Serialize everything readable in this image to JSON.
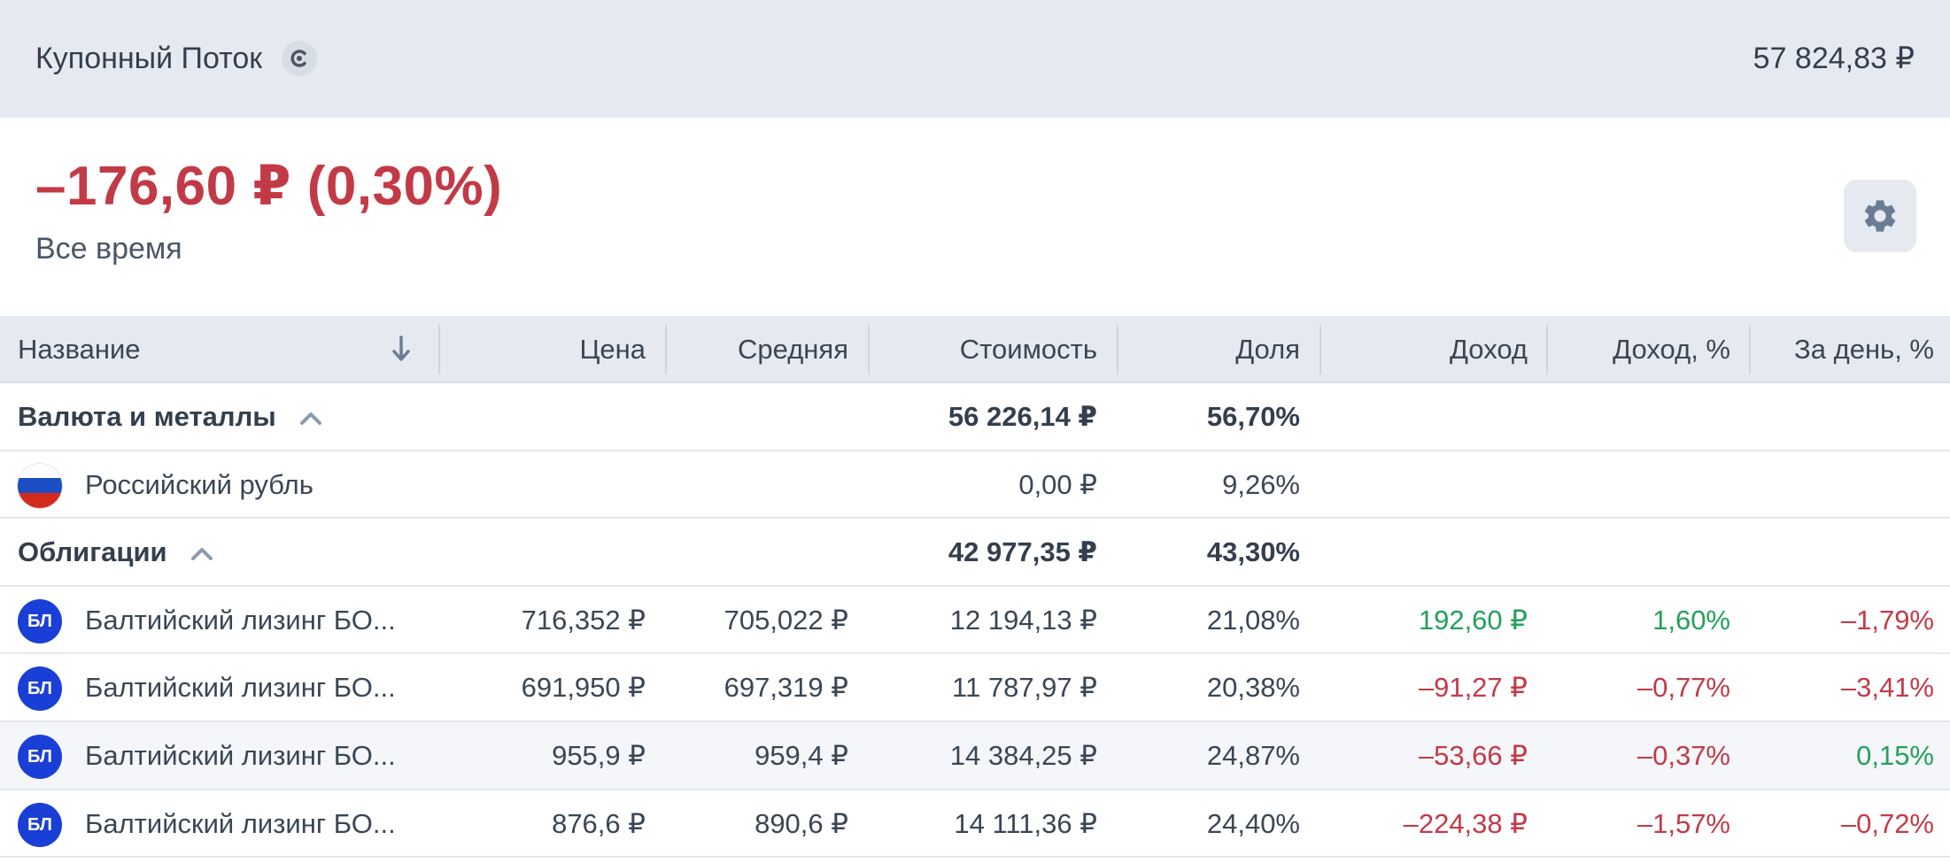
{
  "header": {
    "portfolio_name": "Купонный Поток",
    "portfolio_icon": "c-icon",
    "total_value": "57 824,83 ₽"
  },
  "summary": {
    "profit": "–176,60 ₽ (0,30%)",
    "period": "Все время",
    "settings_icon": "gear-icon"
  },
  "table": {
    "columns": {
      "name": "Название",
      "price": "Цена",
      "avg": "Средняя",
      "cost": "Стоимость",
      "share": "Доля",
      "income": "Доход",
      "income_pct": "Доход, %",
      "day": "За день, %"
    },
    "groups": [
      {
        "label": "Валюта и металлы",
        "cost": "56 226,14 ₽",
        "share": "56,70%",
        "rows": [
          {
            "name": "Российский рубль",
            "cost": "0,00 ₽",
            "share": "9,26%"
          }
        ]
      },
      {
        "label": "Облигации",
        "cost": "42 977,35 ₽",
        "share": "43,30%",
        "rows": [
          {
            "badge": "БЛ",
            "name": "Балтийский лизинг БО...",
            "price": "716,352 ₽",
            "avg": "705,022 ₽",
            "cost": "12 194,13 ₽",
            "share": "21,08%",
            "income": "192,60 ₽",
            "income_pct": "1,60%",
            "day": "–1,79%"
          },
          {
            "badge": "БЛ",
            "name": "Балтийский лизинг БО...",
            "price": "691,950 ₽",
            "avg": "697,319 ₽",
            "cost": "11 787,97 ₽",
            "share": "20,38%",
            "income": "–91,27 ₽",
            "income_pct": "–0,77%",
            "day": "–3,41%"
          },
          {
            "badge": "БЛ",
            "name": "Балтийский лизинг БО...",
            "price": "955,9 ₽",
            "avg": "959,4 ₽",
            "cost": "14 384,25 ₽",
            "share": "24,87%",
            "income": "–53,66 ₽",
            "income_pct": "–0,37%",
            "day": "0,15%"
          },
          {
            "badge": "БЛ",
            "name": "Балтийский лизинг БО...",
            "price": "876,6 ₽",
            "avg": "890,6 ₽",
            "cost": "14 111,36 ₽",
            "share": "24,40%",
            "income": "–224,38 ₽",
            "income_pct": "–1,57%",
            "day": "–0,72%"
          }
        ]
      }
    ]
  },
  "colors": {
    "negative": "#c33a47",
    "positive": "#23a15a",
    "badge": "#1a3fd6",
    "header_bg": "#e6eaf0"
  }
}
